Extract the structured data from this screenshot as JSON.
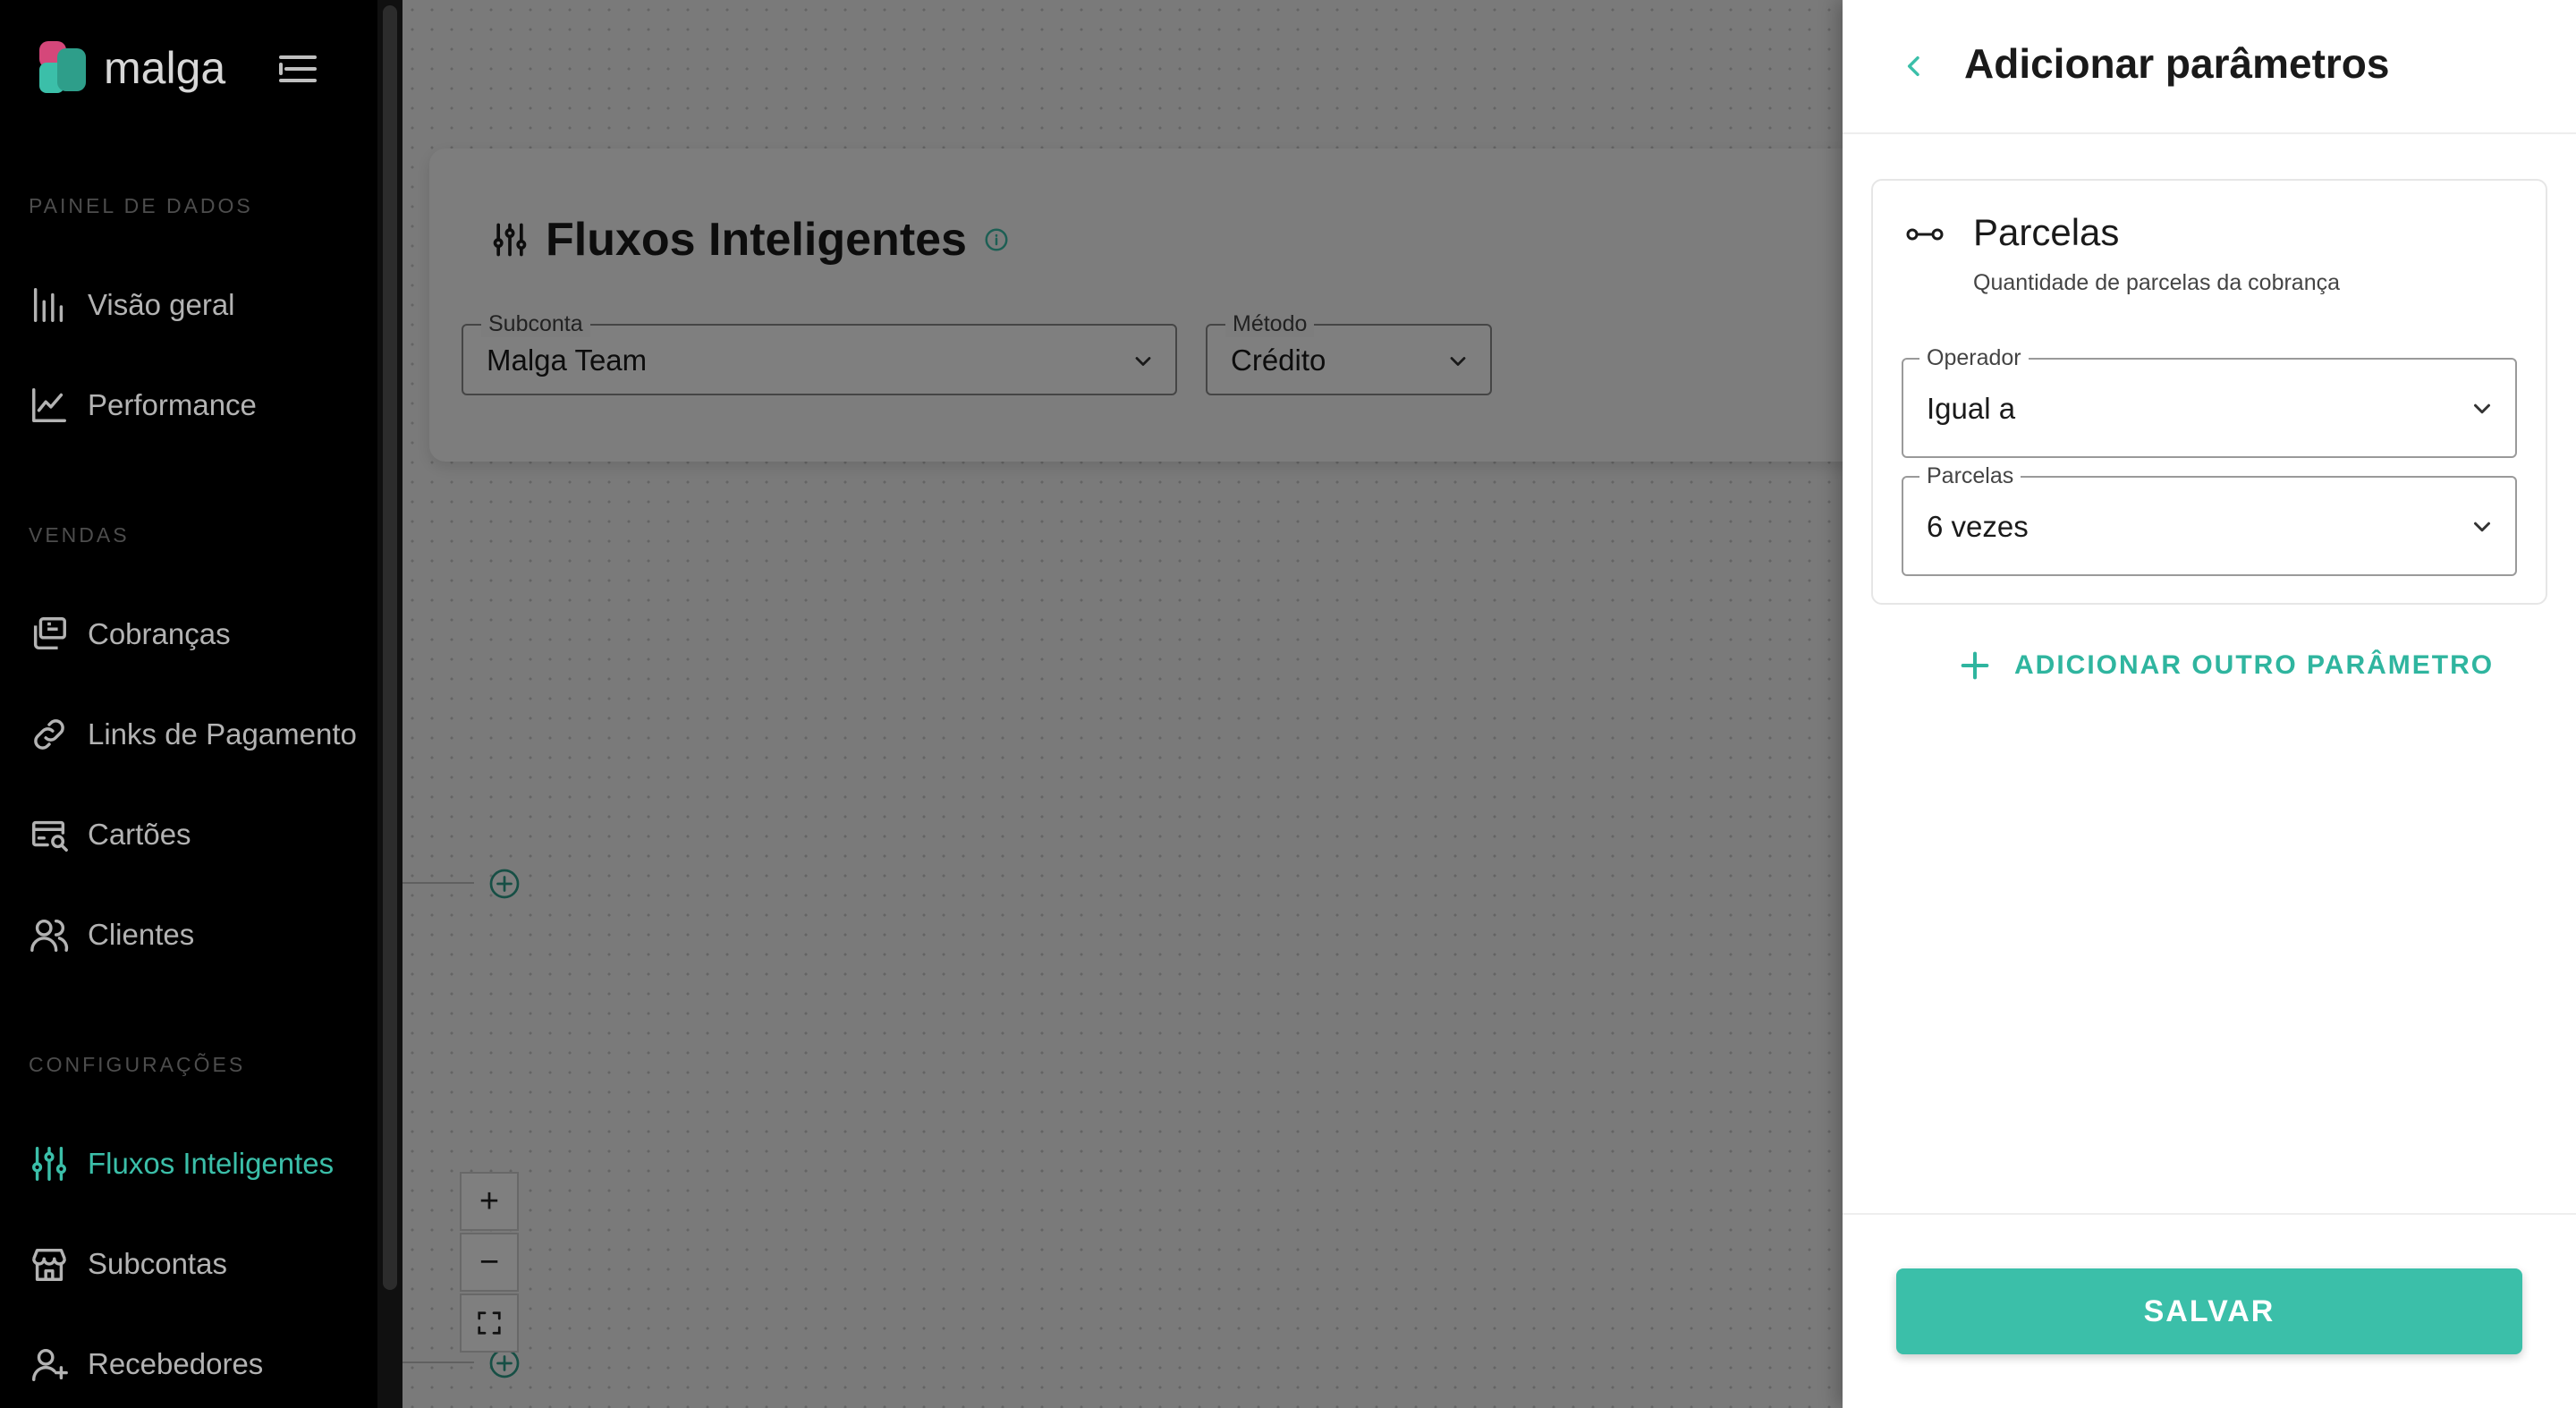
{
  "brand": {
    "name": "malga"
  },
  "sidebar": {
    "sections": [
      {
        "label": "PAINEL DE DADOS"
      },
      {
        "label": "VENDAS"
      },
      {
        "label": "CONFIGURAÇÕES"
      }
    ],
    "items": [
      {
        "label": "Visão geral",
        "icon": "bar-chart-icon"
      },
      {
        "label": "Performance",
        "icon": "line-chart-icon"
      },
      {
        "label": "Cobranças",
        "icon": "charges-icon"
      },
      {
        "label": "Links de Pagamento",
        "icon": "link-icon"
      },
      {
        "label": "Cartões",
        "icon": "card-search-icon"
      },
      {
        "label": "Clientes",
        "icon": "users-icon"
      },
      {
        "label": "Fluxos Inteligentes",
        "icon": "sliders-icon",
        "active": true
      },
      {
        "label": "Subcontas",
        "icon": "store-icon"
      },
      {
        "label": "Recebedores",
        "icon": "user-plus-icon"
      }
    ]
  },
  "main": {
    "title": "Fluxos Inteligentes",
    "subconta": {
      "label": "Subconta",
      "value": "Malga Team"
    },
    "metodo": {
      "label": "Método",
      "value": "Crédito"
    },
    "zoom": {
      "in": "+",
      "out": "−"
    }
  },
  "drawer": {
    "title": "Adicionar parâmetros",
    "param": {
      "title": "Parcelas",
      "description": "Quantidade de parcelas da cobrança",
      "operator": {
        "label": "Operador",
        "value": "Igual a"
      },
      "parcelas": {
        "label": "Parcelas",
        "value": "6 vezes"
      }
    },
    "add_param_label": "ADICIONAR OUTRO PARÂMETRO",
    "save_label": "SALVAR"
  },
  "colors": {
    "accent": "#3bbfa9",
    "sidebar_bg": "#000000"
  }
}
